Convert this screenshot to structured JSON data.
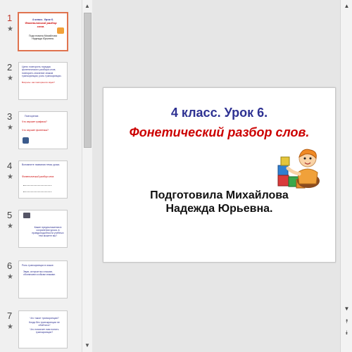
{
  "thumbnails": [
    {
      "number": "1",
      "lines": [
        "4 класс. Урок 6.",
        "Фонетический разбор слов.",
        "Подготовила Михайлова Надежда Юрьевна."
      ]
    },
    {
      "number": "2",
      "lines": [
        "Цели: повторить порядок фонетического разбора слов;",
        "повторить значение знаков транскрипции; роль транскрипции.",
        "Вопросы: как повторяются звуки?"
      ]
    },
    {
      "number": "3",
      "lines": [
        "Повторение.",
        "Что изучает графика?",
        "Что изучает фонетика?"
      ]
    },
    {
      "number": "4",
      "lines": [
        "Вспомните названия темы урока.",
        "Фонетический разбор слов."
      ]
    },
    {
      "number": "5",
      "lines": [
        "Какие предположения в сохранении урока, в правдоподобности учебных тем можете вы?"
      ]
    },
    {
      "number": "6",
      "lines": [
        "Роль транскрипции в языке.",
        "Звуки, которые мы слышим, обозначаем особыми знаками."
      ]
    },
    {
      "number": "7",
      "lines": [
        "Что такое транскрипция?",
        "Когда без транскрипции не обойтись?",
        "Что помогает нам понять транскрипция?"
      ]
    }
  ],
  "slide": {
    "title_line1": "4 класс. Урок 6.",
    "title_line2": "Фонетический разбор слов.",
    "subtitle": "Подготовила Михайлова Надежда Юрьевна."
  },
  "icons": {
    "star": "☆",
    "up": "▲",
    "down": "▼",
    "prev_slide": "⯭",
    "next_slide": "⯯"
  },
  "colors": {
    "title_blue": "#2e3192",
    "title_red": "#cc0000",
    "active_border": "#e0734f"
  }
}
